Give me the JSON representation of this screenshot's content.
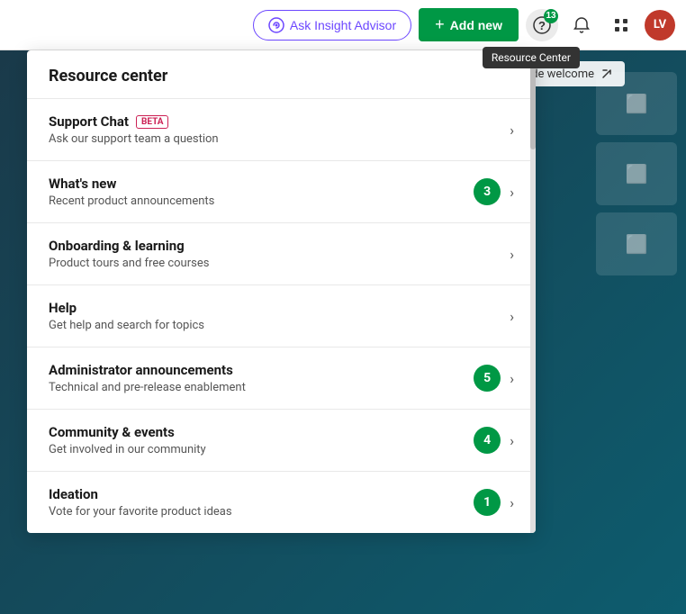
{
  "header": {
    "insight_advisor_label": "Ask Insight Advisor",
    "add_new_label": "Add new",
    "notification_count": "13",
    "avatar_initials": "LV",
    "tooltip_text": "Resource Center"
  },
  "resource_panel": {
    "title": "Resource center",
    "items": [
      {
        "id": "support-chat",
        "title": "Support Chat",
        "beta": true,
        "description": "Ask our support team a question",
        "count": null
      },
      {
        "id": "whats-new",
        "title": "What's new",
        "beta": false,
        "description": "Recent product announcements",
        "count": "3"
      },
      {
        "id": "onboarding",
        "title": "Onboarding & learning",
        "beta": false,
        "description": "Product tours and free courses",
        "count": null
      },
      {
        "id": "help",
        "title": "Help",
        "beta": false,
        "description": "Get help and search for topics",
        "count": null
      },
      {
        "id": "admin-announcements",
        "title": "Administrator announcements",
        "beta": false,
        "description": "Technical and pre-release enablement",
        "count": "5"
      },
      {
        "id": "community",
        "title": "Community & events",
        "beta": false,
        "description": "Get involved in our community",
        "count": "4"
      },
      {
        "id": "ideation",
        "title": "Ideation",
        "beta": false,
        "description": "Vote for your favorite product ideas",
        "count": "1"
      }
    ]
  },
  "hide_welcome": "Hide welcome",
  "labels": {
    "beta": "BETA",
    "plus": "+",
    "chevron": "›"
  }
}
